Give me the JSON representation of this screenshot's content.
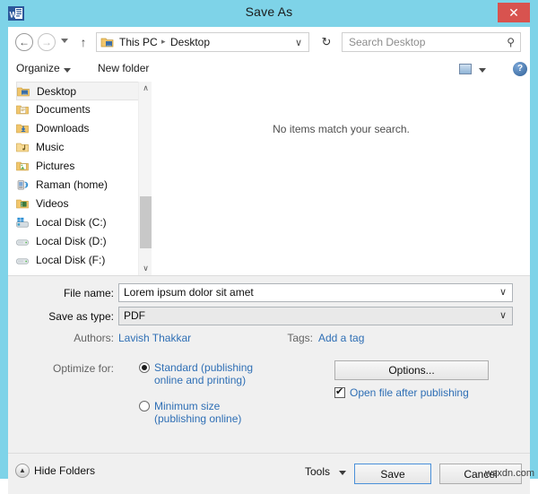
{
  "window": {
    "title": "Save As",
    "app_icon": "word-icon",
    "close_label": "✕",
    "accent_color": "#7ed3e8",
    "close_color": "#d8534f"
  },
  "navbar": {
    "back_icon": "←",
    "forward_icon": "→",
    "recent_icon": "chevron-down-icon",
    "up_icon": "↑",
    "breadcrumbs": [
      "This PC",
      "Desktop"
    ],
    "separator": "▸",
    "dropdown_caret": "∨",
    "refresh_icon": "↻",
    "search_placeholder": "Search Desktop",
    "search_value": "",
    "search_icon": "⚲"
  },
  "toolbar": {
    "organize_label": "Organize",
    "new_folder_label": "New folder",
    "view_icon": "preview-pane-icon",
    "help_icon": "?"
  },
  "tree": {
    "items": [
      {
        "label": "Desktop",
        "icon": "desktop-folder-icon",
        "selected": true
      },
      {
        "label": "Documents",
        "icon": "documents-folder-icon",
        "selected": false
      },
      {
        "label": "Downloads",
        "icon": "downloads-folder-icon",
        "selected": false
      },
      {
        "label": "Music",
        "icon": "music-folder-icon",
        "selected": false
      },
      {
        "label": "Pictures",
        "icon": "pictures-folder-icon",
        "selected": false
      },
      {
        "label": "Raman (home)",
        "icon": "homegroup-icon",
        "selected": false
      },
      {
        "label": "Videos",
        "icon": "videos-folder-icon",
        "selected": false
      },
      {
        "label": "Local Disk (C:)",
        "icon": "system-drive-icon",
        "selected": false
      },
      {
        "label": "Local Disk (D:)",
        "icon": "drive-icon",
        "selected": false
      },
      {
        "label": "Local Disk (F:)",
        "icon": "drive-icon",
        "selected": false
      }
    ],
    "scroll_up_icon": "∧",
    "scroll_down_icon": "∨"
  },
  "filelist": {
    "empty_message": "No items match your search."
  },
  "form": {
    "file_name_label": "File name:",
    "file_name_value": "Lorem ipsum dolor sit amet",
    "save_as_type_label": "Save as type:",
    "save_as_type_value": "PDF",
    "authors_label": "Authors:",
    "authors_value": "Lavish Thakkar",
    "tags_label": "Tags:",
    "tags_value": "Add a tag",
    "optimize_label": "Optimize for:",
    "optimize_options": [
      {
        "line1": "Standard (publishing",
        "line2": "online and printing)",
        "checked": true
      },
      {
        "line1": "Minimum size",
        "line2": "(publishing online)",
        "checked": false
      }
    ],
    "options_button_label": "Options...",
    "open_after_publishing_label": "Open file after publishing",
    "open_after_publishing_checked": true,
    "link_color": "#2f6fb5"
  },
  "footer": {
    "hide_folders_label": "Hide Folders",
    "hide_folders_icon": "▲",
    "tools_label": "Tools",
    "tools_caret": "chevron-down-icon",
    "save_label": "Save",
    "cancel_label": "Cancel"
  },
  "watermark": {
    "text": "wsxdn.com"
  }
}
